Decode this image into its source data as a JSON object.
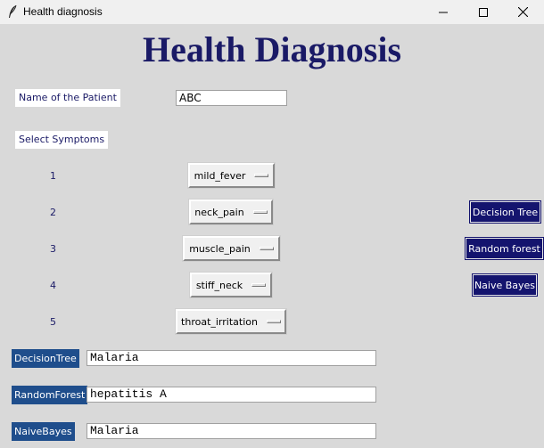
{
  "window": {
    "title": "Health diagnosis",
    "icon": "feather-icon",
    "controls": [
      "minimize-icon",
      "maximize-icon",
      "close-icon"
    ]
  },
  "heading": "Health Diagnosis",
  "patient": {
    "label": "Name of the Patient",
    "value": "ABC"
  },
  "symptoms": {
    "label": "Select Symptoms",
    "items": [
      {
        "index": "1",
        "selected": "mild_fever"
      },
      {
        "index": "2",
        "selected": "neck_pain"
      },
      {
        "index": "3",
        "selected": "muscle_pain"
      },
      {
        "index": "4",
        "selected": "stiff_neck"
      },
      {
        "index": "5",
        "selected": "throat_irritation"
      }
    ]
  },
  "buttons": {
    "decision_tree": "Decision Tree",
    "random_forest": "Random forest",
    "naive_bayes": "Naive Bayes"
  },
  "results": [
    {
      "label": "DecisionTree",
      "value": "Malaria"
    },
    {
      "label": "RandomForest",
      "value": "hepatitis A"
    },
    {
      "label": "NaiveBayes",
      "value": "Malaria"
    }
  ],
  "colors": {
    "accent": "#14146e",
    "heading": "#1a1a66",
    "result_label_bg": "#1f4e8c",
    "window_bg": "#d9d9d9"
  }
}
